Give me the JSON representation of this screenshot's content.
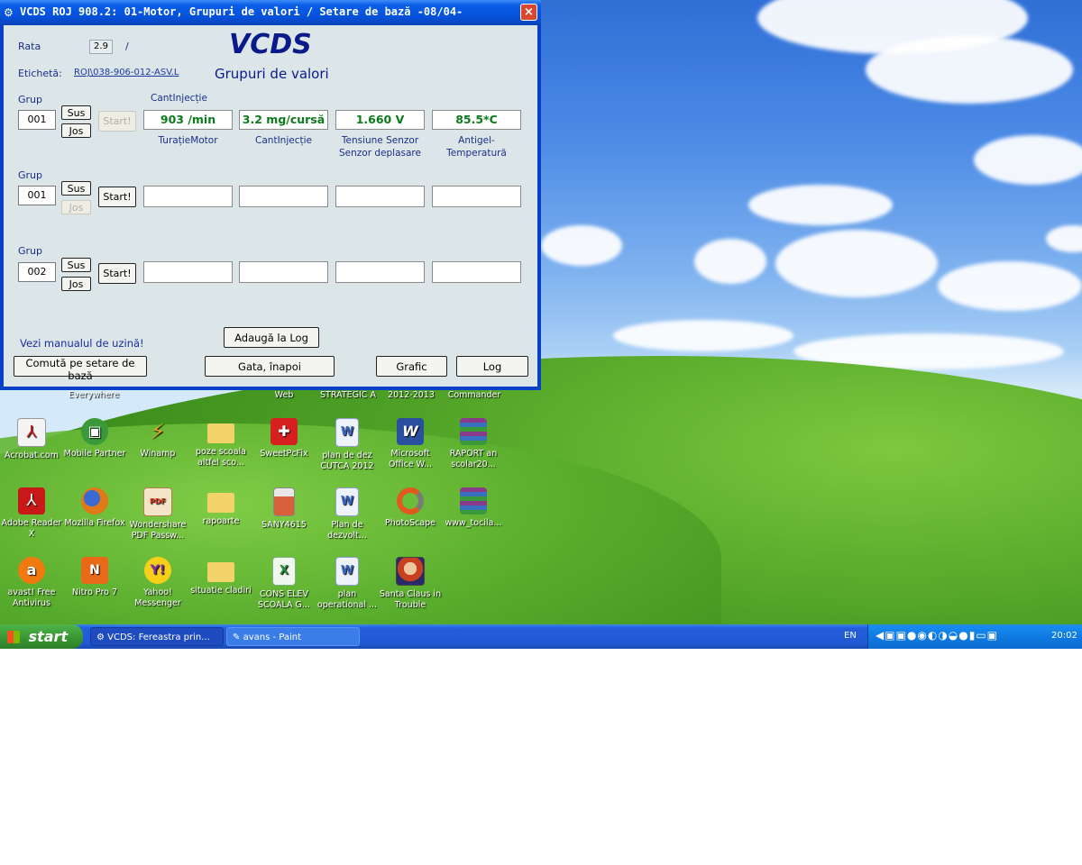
{
  "window": {
    "title": "VCDS ROJ 908.2: 01-Motor,  Grupuri de valori / Setare de bază -08/04-",
    "close_glyph": "×",
    "brand": "VCDS",
    "subtitle": "Grupuri de valori",
    "rate_label": "Rata",
    "rate_value": "2.9",
    "rate_sep": "/",
    "label_label": "Etichetă:",
    "label_link": "ROJ\\038-906-012-ASV.L"
  },
  "groups": [
    {
      "group_label": "Grup",
      "group_value": "001",
      "up_label": "Sus",
      "down_label": "Jos",
      "start_label": "Start!",
      "top_caption": "CantInjecție",
      "values": [
        "903 /min",
        "3.2 mg/cursă",
        "1.660 V",
        "85.5*C"
      ],
      "captions": [
        "TurațieMotor",
        "CantInjecție",
        "Tensiune Senzor\nSenzor deplasare",
        "Antigel-\nTemperatură"
      ]
    },
    {
      "group_label": "Grup",
      "group_value": "001",
      "up_label": "Sus",
      "down_label": "Jos",
      "start_label": "Start!",
      "values": [
        "",
        "",
        "",
        ""
      ]
    },
    {
      "group_label": "Grup",
      "group_value": "002",
      "up_label": "Sus",
      "down_label": "Jos",
      "start_label": "Start!",
      "values": [
        "",
        "",
        "",
        ""
      ]
    }
  ],
  "footer": {
    "manual_text": "Vezi manualul de uzină!",
    "basic_setting_button": "Comută pe setare de bază",
    "add_log_button": "Adaugă la Log",
    "done_button": "Gata, înapoi",
    "graph_button": "Grafic",
    "log_button": "Log"
  },
  "desktop": {
    "top_row_labels": [
      "Everywhere",
      "Web",
      "STRATEGIC A",
      "2012-2013",
      "Commander"
    ],
    "icons": [
      {
        "label": "Acrobat.com",
        "icon": "acrobat-icon",
        "color": "#ffffff"
      },
      {
        "label": "Mobile Partner",
        "icon": "mobile-partner-icon",
        "color": "#3a9a3a"
      },
      {
        "label": "Winamp",
        "icon": "winamp-icon",
        "color": "#e0a020"
      },
      {
        "label": "poze scoala altfel sco...",
        "icon": "folder-icon",
        "color": "#f1d36a"
      },
      {
        "label": "SweetPcFix",
        "icon": "sweetpcfix-icon",
        "color": "#d62020"
      },
      {
        "label": "plan de dez CUTCA 2012",
        "icon": "word-doc-icon",
        "color": "#3a66c4"
      },
      {
        "label": "Microsoft Office W...",
        "icon": "word-icon",
        "color": "#2a4f9e"
      },
      {
        "label": "RAPORT an scolar20...",
        "icon": "winrar-icon",
        "color": "#8a3a8a"
      },
      {
        "label": "Adobe Reader X",
        "icon": "adobe-reader-icon",
        "color": "#c81818"
      },
      {
        "label": "Mozilla Firefox",
        "icon": "firefox-icon",
        "color": "#e07a18"
      },
      {
        "label": "Wondershare PDF Passw...",
        "icon": "wondershare-icon",
        "color": "#d84020"
      },
      {
        "label": "rapoarte",
        "icon": "folder-icon",
        "color": "#f1d36a"
      },
      {
        "label": "SANY4615",
        "icon": "image-file-icon",
        "color": "#e8e8e8"
      },
      {
        "label": "Plan de dezvolt...",
        "icon": "word-doc-icon",
        "color": "#3a66c4"
      },
      {
        "label": "PhotoScape",
        "icon": "photoscape-icon",
        "color": "#e05a20"
      },
      {
        "label": "www_tocila...",
        "icon": "winrar-icon",
        "color": "#8a3a8a"
      },
      {
        "label": "avast! Free Antivirus",
        "icon": "avast-icon",
        "color": "#f07a10"
      },
      {
        "label": "Nitro Pro 7",
        "icon": "nitro-icon",
        "color": "#e86a18"
      },
      {
        "label": "Yahoo! Messenger",
        "icon": "yahoo-messenger-icon",
        "color": "#7a2ab0"
      },
      {
        "label": "situatie cladiri",
        "icon": "folder-icon",
        "color": "#f1d36a"
      },
      {
        "label": "CONS ELEV SCOALA G...",
        "icon": "excel-doc-icon",
        "color": "#2a8a3a"
      },
      {
        "label": "plan operational ...",
        "icon": "word-doc-icon",
        "color": "#3a66c4"
      },
      {
        "label": "Santa Claus in Trouble",
        "icon": "game-icon",
        "color": "#c84020"
      }
    ]
  },
  "taskbar": {
    "start_label": "start",
    "task1": "VCDS:  Fereastra prin...",
    "task2": "avans - Paint",
    "lang": "EN",
    "clock": "20:02"
  }
}
